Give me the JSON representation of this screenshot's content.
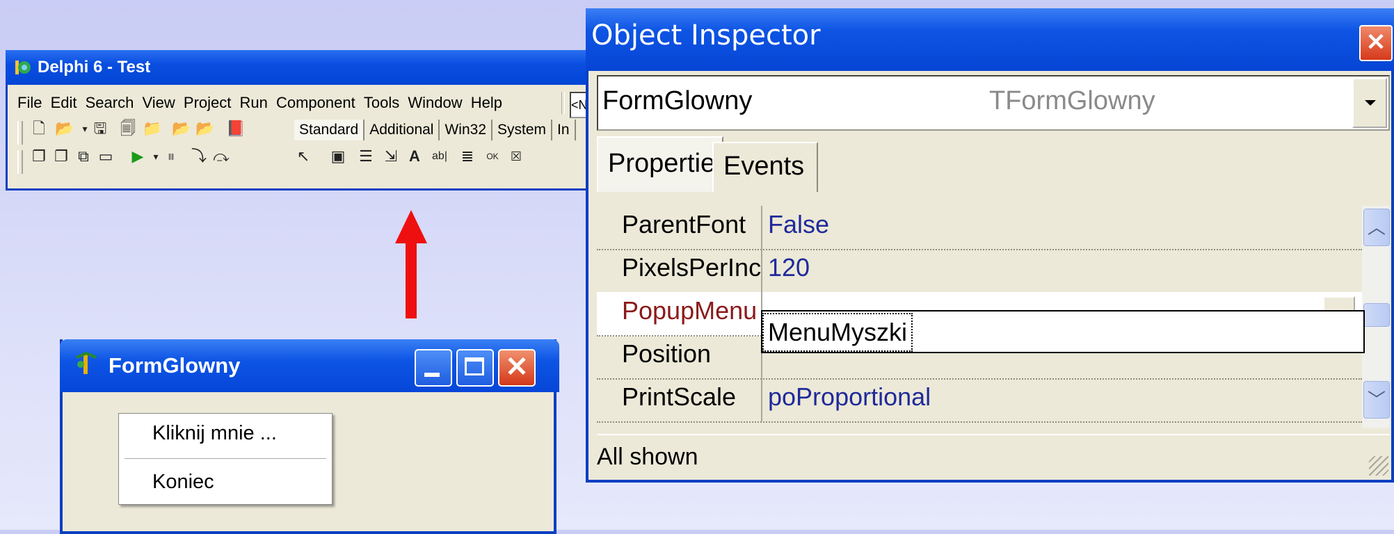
{
  "ide": {
    "title": "Delphi 6 - Test",
    "menu": [
      "File",
      "Edit",
      "Search",
      "View",
      "Project",
      "Run",
      "Component",
      "Tools",
      "Window",
      "Help"
    ],
    "combo_text": "<No",
    "palette_tabs": [
      "Standard",
      "Additional",
      "Win32",
      "System",
      "In"
    ],
    "palette_active": "Standard"
  },
  "inspector": {
    "title": "Object Inspector",
    "close_glyph": "✕",
    "object_name": "FormGlowny",
    "object_class": "TFormGlowny",
    "tabs": [
      "Properties",
      "Events"
    ],
    "properties": [
      {
        "name": "ParentFont",
        "value": "False"
      },
      {
        "name": "PixelsPerInch",
        "value": "120"
      },
      {
        "name": "PopupMenu",
        "value": ""
      },
      {
        "name": "Position",
        "value": ""
      },
      {
        "name": "PrintScale",
        "value": "poProportional"
      }
    ],
    "dropdown_item": "MenuMyszki",
    "status": "All shown"
  },
  "form": {
    "title": "FormGlowny",
    "context_menu": [
      "Kliknij mnie ...",
      "Koniec"
    ]
  },
  "colors": {
    "xp_blue": "#0646d8",
    "arrow_red": "#ee1010",
    "value_blue": "#1f2a9a",
    "selected_key": "#8b1a1a"
  }
}
